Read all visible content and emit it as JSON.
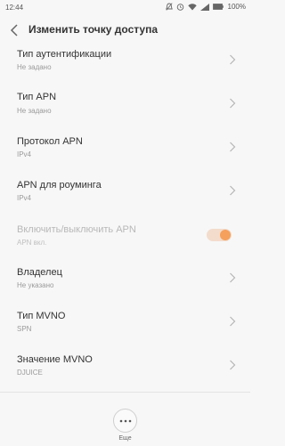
{
  "status": {
    "time": "12:44",
    "battery": "100%"
  },
  "header": {
    "title": "Изменить точку доступа"
  },
  "rows": [
    {
      "label": "Тип аутентификации",
      "sub": "Не задано"
    },
    {
      "label": "Тип APN",
      "sub": "Не задано"
    },
    {
      "label": "Протокол APN",
      "sub": "IPv4"
    },
    {
      "label": "APN для роуминга",
      "sub": "IPv4"
    },
    {
      "label": "Включить/выключить APN",
      "sub": "APN вкл."
    },
    {
      "label": "Владелец",
      "sub": "Не указано"
    },
    {
      "label": "Тип MVNO",
      "sub": "SPN"
    },
    {
      "label": "Значение MVNO",
      "sub": "DJUICE"
    }
  ],
  "apn_toggle": {
    "state": "on",
    "enabled": false
  },
  "bottom": {
    "more_label": "Еще"
  },
  "colors": {
    "accent": "#f5a05c",
    "background": "#f7f7f7"
  },
  "icons": [
    "back-arrow-icon",
    "chevron-right-icon",
    "more-dots-icon",
    "wifi-icon",
    "signal-icon",
    "battery-icon",
    "alarm-icon"
  ]
}
